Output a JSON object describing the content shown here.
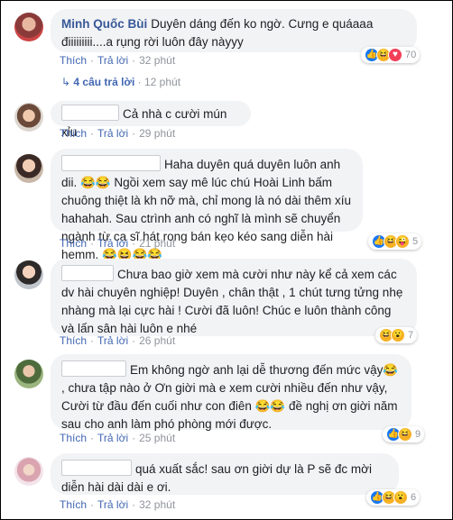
{
  "comments": [
    {
      "author": "Minh Quốc Bùi",
      "text": "Duyên dáng đến ko ngờ. Cưng e quáaaa điiiiiiiii....a rụng rời luôn đây nàyyy",
      "like": "Thích",
      "reply": "Trả lời",
      "time": "32 phút",
      "reaction_count": "70"
    },
    {
      "author": "",
      "text": "Cả nhà c cười mún xỉu",
      "like": "Thích",
      "reply": "Trả lời",
      "time": "29 phút"
    },
    {
      "author": "",
      "text": "Haha duyên quá duyên luôn anh dii. 😂😂 Ngồi xem say mê lúc chú Hoài Linh bấm chuông thiệt là kh nỡ mà, chỉ mong là nó dài thêm xíu hahahah. Sau ctrình anh có nghĩ là mình sẽ chuyển ngành từ ca sĩ hát rong bán kẹo kéo sang diễn hài hemm. 😂😆😂😂",
      "like": "Thích",
      "reply": "Trả lời",
      "time": "21 phút",
      "reaction_count": "5"
    },
    {
      "author": "",
      "text": "Chưa bao giờ xem mà cười như này kể cả xem các dv hài chuyên nghiệp! Duyên , chân thật , 1 chút tưng tửng nhẹ nhàng mà lại cực hài ! Cười đã luôn! Chúc e luôn thành công và lấn sân hài luôn e nhé",
      "like": "Thích",
      "reply": "Trả lời",
      "time": "26 phút",
      "reaction_count": "7"
    },
    {
      "author": "",
      "text": "Em không ngờ anh lại dễ thương đến mức vậy😂 , chưa tập nào ở Ơn giời mà e xem cười nhiều đến như vậy, Cười từ đầu đến cuối như con điên 😂😂 đề nghị ơn giời năm sau cho anh làm phó phòng mới được.",
      "like": "Thích",
      "reply": "Trả lời",
      "time": "25 phút",
      "reaction_count": "9"
    },
    {
      "author": "",
      "text": "quá xuất sắc! sau ơn giời dự là P sẽ đc mời diễn hài dài dài e ơi.",
      "like": "Thích",
      "reply": "Trả lời",
      "time": "32 phút",
      "reaction_count": "6"
    }
  ],
  "replies_link": "4 câu trả lời",
  "replies_time": "12 phút",
  "sep": "·",
  "colors": {
    "link": "#385898",
    "bubble": "#f2f3f5",
    "like": "#1877f2",
    "haha": "#f7b125"
  }
}
